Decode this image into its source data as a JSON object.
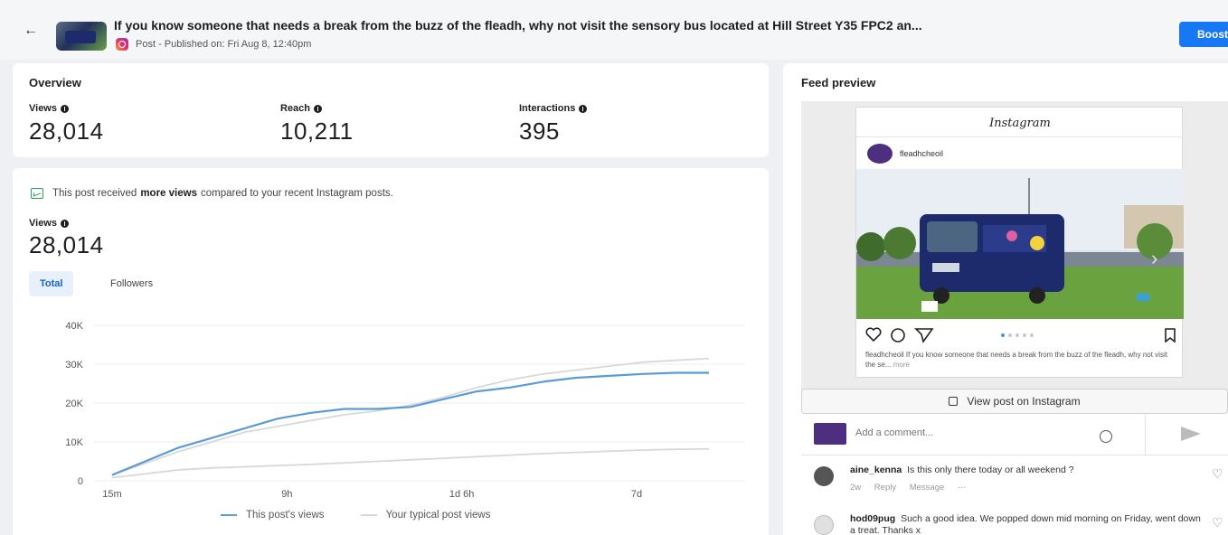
{
  "header": {
    "title": "If you know someone that needs a break from the buzz of the fleadh, why not visit the sensory bus located at Hill Street Y35 FPC2 an...",
    "meta": "Post - Published on: Fri Aug 8, 12:40pm",
    "boost_label": "Boost"
  },
  "overview": {
    "title": "Overview",
    "metrics": [
      {
        "label": "Views",
        "value": "28,014"
      },
      {
        "label": "Reach",
        "value": "10,211"
      },
      {
        "label": "Interactions",
        "value": "395"
      }
    ]
  },
  "views_card": {
    "insight_pre": "This post received",
    "insight_bold": "more views",
    "insight_post": "compared to your recent Instagram posts.",
    "label": "Views",
    "value": "28,014",
    "tabs": [
      "Total",
      "Followers"
    ]
  },
  "chart_data": {
    "type": "line",
    "x_ticks": [
      "15m",
      "9h",
      "1d 6h",
      "7d"
    ],
    "y_ticks": [
      "0",
      "10K",
      "20K",
      "30K",
      "40K"
    ],
    "ylim": [
      0,
      40000
    ],
    "grid": true,
    "legend": "bottom-center",
    "x": [
      0,
      2,
      4,
      6,
      8,
      10,
      12,
      14,
      16,
      18,
      20,
      22,
      24,
      26,
      28,
      30,
      32,
      34,
      36
    ],
    "series": [
      {
        "name": "This post's views",
        "color": "#5b9bd5",
        "values": [
          1500,
          5000,
          8500,
          11000,
          13500,
          16000,
          17500,
          18500,
          18500,
          19000,
          21000,
          23000,
          24000,
          25500,
          26500,
          27000,
          27500,
          27800,
          27800
        ]
      },
      {
        "name": "Your typical post views",
        "color": "#d8d8d8",
        "values": [
          1500,
          4500,
          7500,
          10000,
          12500,
          14000,
          15500,
          17000,
          18000,
          19500,
          21500,
          24000,
          26000,
          27500,
          28500,
          29500,
          30500,
          31000,
          31500
        ]
      },
      {
        "name": "",
        "color": "#d8d8d8",
        "values": [
          800,
          1800,
          2800,
          3300,
          3600,
          3900,
          4200,
          4600,
          5000,
          5400,
          5800,
          6200,
          6600,
          7000,
          7300,
          7600,
          7900,
          8100,
          8200
        ]
      }
    ]
  },
  "feed": {
    "title": "Feed preview",
    "ig_logo": "Instagram",
    "username": "fleadhcheoil",
    "caption": "fleadhcheoil If you know someone that needs a break from the buzz of the fleadh, why not visit the se...",
    "caption_more": "more",
    "view_on_ig": "View post on Instagram",
    "comment_placeholder": "Add a comment...",
    "comments": [
      {
        "user": "aine_kenna",
        "text": "Is this only there today or all weekend ?",
        "meta": [
          "2w",
          "Reply",
          "Message",
          "···"
        ]
      },
      {
        "user": "hod09pug",
        "text": "Such a good idea. We popped down mid morning on Friday, went down a treat. Thanks x",
        "meta": []
      }
    ]
  }
}
